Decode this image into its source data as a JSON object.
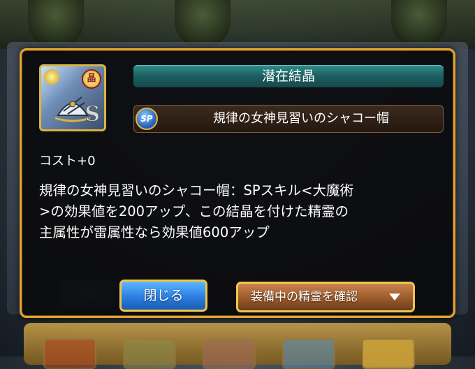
{
  "dialog": {
    "title": "潜在結晶",
    "item_name": "規律の女神見習いのシャコー帽",
    "badge": "SP",
    "rank": "S",
    "crest": "晶",
    "cost": "コスト+0",
    "description_lines": [
      "規律の女神見習いのシャコー帽：SPスキル<大魔術",
      ">の効果値を200アップ、この結晶を付けた精霊の",
      "主属性が雷属性なら効果値600アップ"
    ],
    "close_label": "閉じる",
    "check_label": "装備中の精霊を確認"
  },
  "background": {
    "back_label": "戻る"
  },
  "colors": {
    "frame": "#e4a32f",
    "title_bar": "#1c5f60",
    "close_button": "#2a7fe0",
    "check_button": "#9a5a2b"
  }
}
